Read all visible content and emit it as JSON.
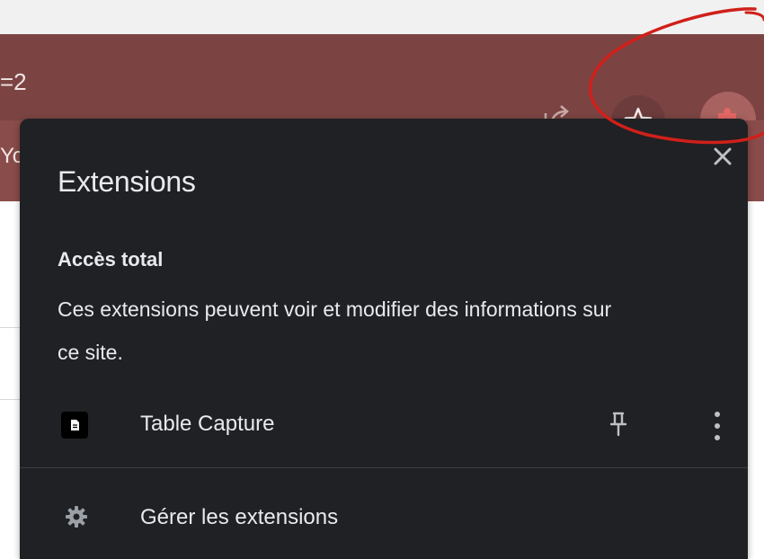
{
  "colors": {
    "toolbar": "#7b4443",
    "bookmark_strip": "#8a4c4a",
    "popup_bg": "#202124",
    "popup_text": "#e8eaed",
    "annotation": "#d0201a"
  },
  "omnibox": {
    "url_fragment": "=2"
  },
  "bookmarks": {
    "fragment": "Yo"
  },
  "toolbar": {
    "icons": [
      "share-icon",
      "star-icon",
      "puzzle-icon"
    ]
  },
  "popup": {
    "title": "Extensions",
    "section_heading": "Accès total",
    "section_desc": "Ces extensions peuvent voir et modifier des informations sur ce site.",
    "extensions": [
      {
        "name": "Table Capture",
        "icon": "document-icon"
      }
    ],
    "manage_label": "Gérer les extensions"
  }
}
